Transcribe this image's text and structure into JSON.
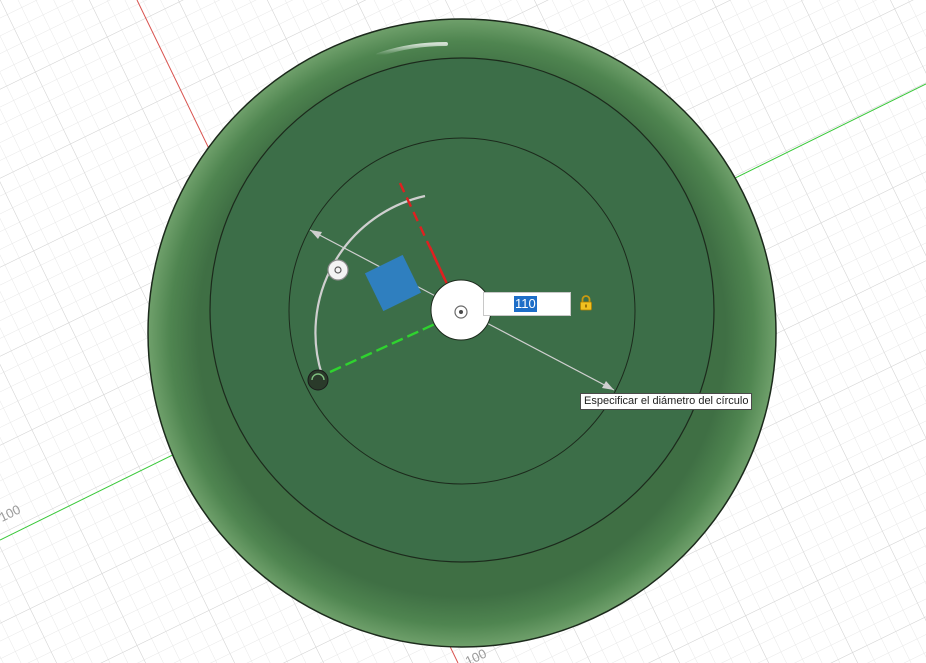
{
  "viewport": {
    "grid_labels": {
      "left": "100",
      "bottom": "100"
    },
    "colors": {
      "background": "#ffffff",
      "grid_minor": "#e8e8e8",
      "grid_major": "#d6d6d6",
      "x_axis": "#d9534f",
      "y_axis": "#33cc33",
      "body_outer": "#4e7f4e",
      "body_inner": "#3b6e47",
      "outline": "#1c2a1c",
      "direction_handle": "#2f7fbf",
      "dimension_arrow": "#cfcfcf",
      "highlight_red": "#e02020",
      "highlight_green": "#2fd32f"
    },
    "icons": {
      "lock": "lock-icon",
      "center_point": "center-point-icon",
      "rotate_handle": "rotate-handle-icon",
      "sweep_handle": "sweep-handle-icon"
    }
  },
  "dimension_input": {
    "value": "110",
    "locked": true
  },
  "tooltip": {
    "text": "Especificar el diámetro del círculo"
  }
}
